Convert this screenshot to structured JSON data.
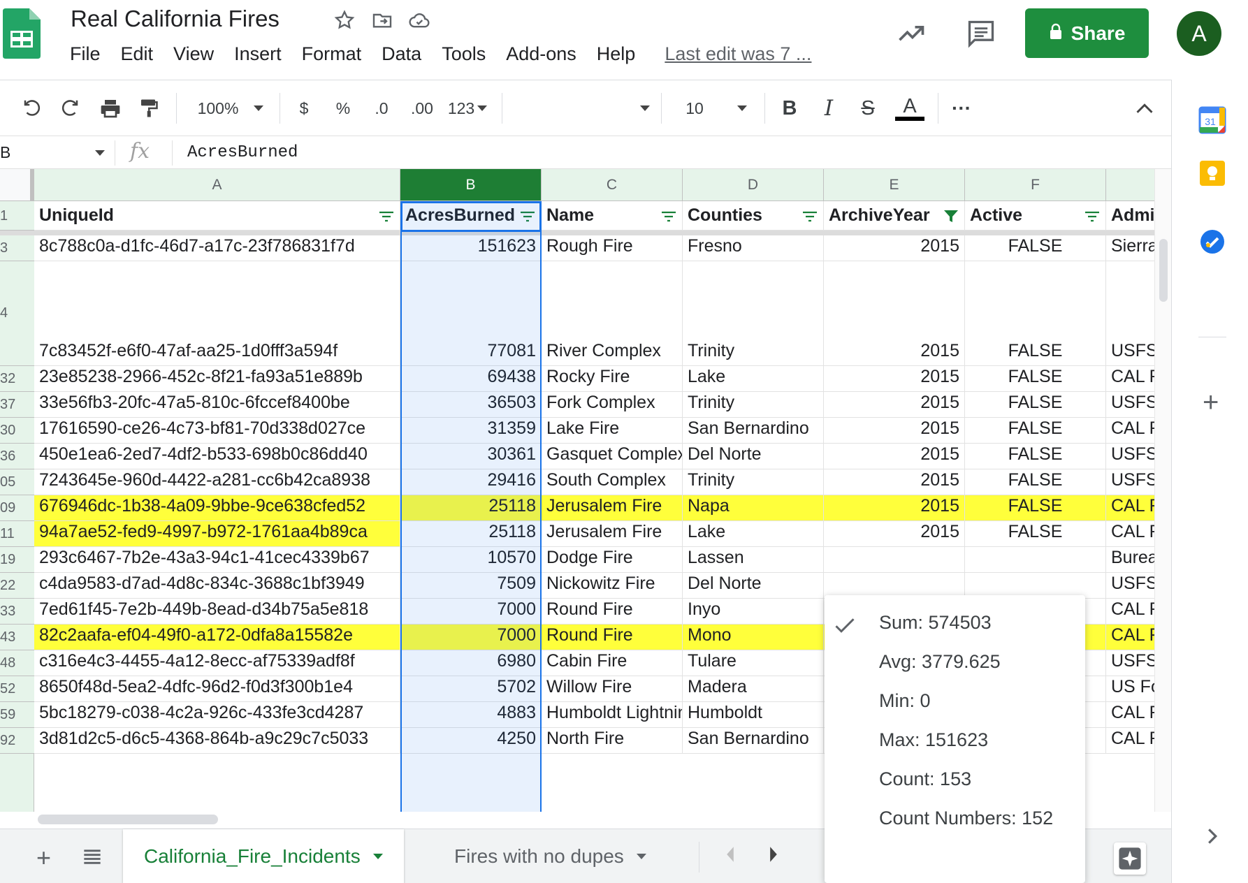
{
  "header": {
    "title": "Real California Fires",
    "menu": [
      "File",
      "Edit",
      "View",
      "Insert",
      "Format",
      "Data",
      "Tools",
      "Add-ons",
      "Help"
    ],
    "last_edit": "Last edit was 7 ...",
    "share_label": "Share",
    "avatar_initial": "A"
  },
  "toolbar": {
    "zoom": "100%",
    "currency": "$",
    "percent": "%",
    "dec_decrease": ".0",
    "dec_increase": ".00",
    "more_formats": "123",
    "font_size": "10",
    "bold": "B",
    "italic": "I",
    "strike": "S",
    "text_color": "A",
    "more": "···"
  },
  "formula_bar": {
    "cell_ref": "B",
    "fx": "fx",
    "value": "AcresBurned"
  },
  "grid": {
    "columns": [
      "A",
      "B",
      "C",
      "D",
      "E",
      "F",
      ""
    ],
    "headers": [
      "UniqueId",
      "AcresBurned",
      "Name",
      "Counties",
      "ArchiveYear",
      "Active",
      "Admi"
    ],
    "rows": [
      {
        "num": "3",
        "cells": [
          "8c788c0a-d1fc-46d7-a17c-23f786831f7d",
          "151623",
          "Rough Fire",
          "Fresno",
          "2015",
          "FALSE",
          "Sierra"
        ],
        "highlight": false,
        "tall": false
      },
      {
        "num": "4",
        "cells": [
          "7c83452f-e6f0-47af-aa25-1d0fff3a594f",
          "77081",
          "River Complex",
          "Trinity",
          "2015",
          "FALSE",
          "USFS"
        ],
        "highlight": false,
        "tall": true
      },
      {
        "num": "32",
        "cells": [
          "23e85238-2966-452c-8f21-fa93a51e889b",
          "69438",
          "Rocky Fire",
          "Lake",
          "2015",
          "FALSE",
          "CAL F"
        ],
        "highlight": false,
        "tall": false
      },
      {
        "num": "37",
        "cells": [
          "33e56fb3-20fc-47a5-810c-6fccef8400be",
          "36503",
          "Fork Complex",
          "Trinity",
          "2015",
          "FALSE",
          "USFS"
        ],
        "highlight": false,
        "tall": false
      },
      {
        "num": "30",
        "cells": [
          "17616590-ce26-4c73-bf81-70d338d027ce",
          "31359",
          "Lake Fire",
          "San Bernardino",
          "2015",
          "FALSE",
          "CAL F"
        ],
        "highlight": false,
        "tall": false
      },
      {
        "num": "36",
        "cells": [
          "450e1ea6-2ed7-4df2-b533-698b0c86dd40",
          "30361",
          "Gasquet Complex",
          "Del Norte",
          "2015",
          "FALSE",
          "USFS"
        ],
        "highlight": false,
        "tall": false
      },
      {
        "num": "05",
        "cells": [
          "7243645e-960d-4422-a281-cc6b42ca8938",
          "29416",
          "South Complex",
          "Trinity",
          "2015",
          "FALSE",
          "USFS"
        ],
        "highlight": false,
        "tall": false
      },
      {
        "num": "09",
        "cells": [
          "676946dc-1b38-4a09-9bbe-9ce638cfed52",
          "25118",
          "Jerusalem Fire",
          "Napa",
          "2015",
          "FALSE",
          "CAL F"
        ],
        "highlight": true,
        "tall": false
      },
      {
        "num": "11",
        "cells": [
          "94a7ae52-fed9-4997-b972-1761aa4b89ca",
          "25118",
          "Jerusalem Fire",
          "Lake",
          "2015",
          "FALSE",
          "CAL F"
        ],
        "highlight": "a",
        "tall": false
      },
      {
        "num": "19",
        "cells": [
          "293c6467-7b2e-43a3-94c1-41cec4339b67",
          "10570",
          "Dodge Fire",
          "Lassen",
          "",
          "",
          "Burea"
        ],
        "highlight": false,
        "tall": false
      },
      {
        "num": "22",
        "cells": [
          "c4da9583-d7ad-4d8c-834c-3688c1bf3949",
          "7509",
          "Nickowitz Fire",
          "Del Norte",
          "",
          "",
          "USFS"
        ],
        "highlight": false,
        "tall": false
      },
      {
        "num": "33",
        "cells": [
          "7ed61f45-7e2b-449b-8ead-d34b75a5e818",
          "7000",
          "Round Fire",
          "Inyo",
          "",
          "",
          "CAL F"
        ],
        "highlight": false,
        "tall": false
      },
      {
        "num": "43",
        "cells": [
          "82c2aafa-ef04-49f0-a172-0dfa8a15582e",
          "7000",
          "Round Fire",
          "Mono",
          "",
          "",
          "CAL F"
        ],
        "highlight": true,
        "tall": false
      },
      {
        "num": "48",
        "cells": [
          "c316e4c3-4455-4a12-8ecc-af75339adf8f",
          "6980",
          "Cabin Fire",
          "Tulare",
          "",
          "",
          "USFS"
        ],
        "highlight": false,
        "tall": false
      },
      {
        "num": "52",
        "cells": [
          "8650f48d-5ea2-4dfc-96d2-f0d3f300b1e4",
          "5702",
          "Willow Fire",
          "Madera",
          "",
          "",
          "US Fo"
        ],
        "highlight": false,
        "tall": false
      },
      {
        "num": "59",
        "cells": [
          "5bc18279-c038-4c2a-926c-433fe3cd4287",
          "4883",
          "Humboldt Lightning",
          "Humboldt",
          "",
          "",
          "CAL F"
        ],
        "highlight": false,
        "tall": false
      },
      {
        "num": "92",
        "cells": [
          "3d81d2c5-d6c5-4368-864b-a9c29c7c5033",
          "4250",
          "North Fire",
          "San Bernardino",
          "",
          "",
          "CAL F"
        ],
        "highlight": false,
        "tall": false
      }
    ]
  },
  "sheet_tabs": {
    "tabs": [
      "California_Fire_Incidents",
      "Fires with no dupes"
    ],
    "active_index": 0
  },
  "stats": {
    "items": [
      "Sum: 574503",
      "Avg: 3779.625",
      "Min: 0",
      "Max: 151623",
      "Count: 153",
      "Count Numbers: 152"
    ],
    "checked_index": 0
  },
  "side_panel": {
    "calendar_day": "31"
  },
  "colors": {
    "accent_green": "#1e8e3e",
    "highlight_yellow": "#ffff3b",
    "selection_blue": "#1a73e8"
  },
  "icons": [
    "star-icon",
    "move-icon",
    "cloud-saved-icon",
    "activity-trend-icon",
    "comment-icon",
    "lock-icon",
    "undo-icon",
    "redo-icon",
    "print-icon",
    "paint-format-icon",
    "filter-icon",
    "calendar-icon",
    "keep-icon",
    "tasks-icon",
    "plus-icon",
    "chevron-right-icon",
    "explore-icon",
    "checkmark-icon"
  ]
}
